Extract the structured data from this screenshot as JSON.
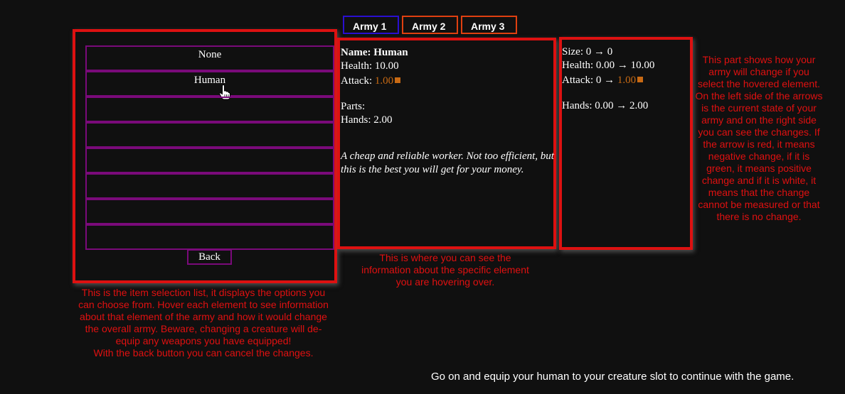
{
  "tabs": [
    {
      "label": "Army 1"
    },
    {
      "label": "Army 2"
    },
    {
      "label": "Army 3"
    }
  ],
  "item_list": {
    "items": [
      {
        "label": "None"
      },
      {
        "label": "Human"
      },
      {
        "label": ""
      },
      {
        "label": ""
      },
      {
        "label": ""
      },
      {
        "label": ""
      },
      {
        "label": ""
      },
      {
        "label": ""
      }
    ],
    "back_label": "Back"
  },
  "info": {
    "name": "Name: Human",
    "health": "Health: 10.00",
    "attack_label": "Attack: ",
    "attack_value": "1.00",
    "parts_label": "Parts:",
    "hands": "Hands: 2.00",
    "description": "A cheap and reliable worker. Not too efficient, but this is the best you will get for your money."
  },
  "changes": {
    "size": "Size: 0 → 0",
    "health": "Health: 0.00 → 10.00",
    "attack_prefix": "Attack: 0 → ",
    "attack_value": "1.00",
    "hands": "Hands: 0.00 → 2.00"
  },
  "notes": {
    "list": "This is the item selection list, it displays the options you can choose from. Hover each element to see information about that element of the army and how it would change the overall army. Beware, changing a creature will de-equip any weapons you have equipped!",
    "list_back": "With the back button you can cancel the changes.",
    "info": "This is where you can see the information about the specific element you are hovering over.",
    "change": "This part shows how your army will change if you select the hovered element. On the left side of the arrows is the current state of your army and on the right side you can see the changes. If the arrow is red, it means negative change, if it is green, it means positive change and if it is white, it means that the change cannot be measured or that there is no change."
  },
  "bottom_message": "Go on and equip your human to your creature slot to continue with the game.",
  "colors": {
    "panel_border": "#dd1111",
    "item_border": "#7a0a7a",
    "accent_orange": "#c86a14",
    "note_red": "#e01010"
  },
  "icons": {
    "cursor": "hand-pointer-icon",
    "attack_marker": "orange-square-icon"
  }
}
